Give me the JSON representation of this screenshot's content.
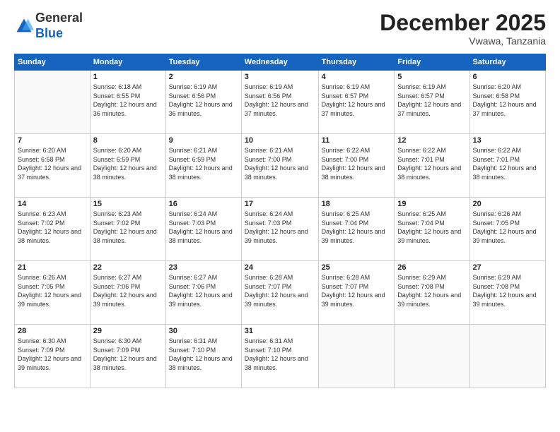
{
  "logo": {
    "general": "General",
    "blue": "Blue"
  },
  "title": "December 2025",
  "location": "Vwawa, Tanzania",
  "days_of_week": [
    "Sunday",
    "Monday",
    "Tuesday",
    "Wednesday",
    "Thursday",
    "Friday",
    "Saturday"
  ],
  "weeks": [
    [
      {
        "day": "",
        "info": ""
      },
      {
        "day": "1",
        "info": "Sunrise: 6:18 AM\nSunset: 6:55 PM\nDaylight: 12 hours\nand 36 minutes."
      },
      {
        "day": "2",
        "info": "Sunrise: 6:19 AM\nSunset: 6:56 PM\nDaylight: 12 hours\nand 36 minutes."
      },
      {
        "day": "3",
        "info": "Sunrise: 6:19 AM\nSunset: 6:56 PM\nDaylight: 12 hours\nand 37 minutes."
      },
      {
        "day": "4",
        "info": "Sunrise: 6:19 AM\nSunset: 6:57 PM\nDaylight: 12 hours\nand 37 minutes."
      },
      {
        "day": "5",
        "info": "Sunrise: 6:19 AM\nSunset: 6:57 PM\nDaylight: 12 hours\nand 37 minutes."
      },
      {
        "day": "6",
        "info": "Sunrise: 6:20 AM\nSunset: 6:58 PM\nDaylight: 12 hours\nand 37 minutes."
      }
    ],
    [
      {
        "day": "7",
        "info": "Sunrise: 6:20 AM\nSunset: 6:58 PM\nDaylight: 12 hours\nand 37 minutes."
      },
      {
        "day": "8",
        "info": "Sunrise: 6:20 AM\nSunset: 6:59 PM\nDaylight: 12 hours\nand 38 minutes."
      },
      {
        "day": "9",
        "info": "Sunrise: 6:21 AM\nSunset: 6:59 PM\nDaylight: 12 hours\nand 38 minutes."
      },
      {
        "day": "10",
        "info": "Sunrise: 6:21 AM\nSunset: 7:00 PM\nDaylight: 12 hours\nand 38 minutes."
      },
      {
        "day": "11",
        "info": "Sunrise: 6:22 AM\nSunset: 7:00 PM\nDaylight: 12 hours\nand 38 minutes."
      },
      {
        "day": "12",
        "info": "Sunrise: 6:22 AM\nSunset: 7:01 PM\nDaylight: 12 hours\nand 38 minutes."
      },
      {
        "day": "13",
        "info": "Sunrise: 6:22 AM\nSunset: 7:01 PM\nDaylight: 12 hours\nand 38 minutes."
      }
    ],
    [
      {
        "day": "14",
        "info": "Sunrise: 6:23 AM\nSunset: 7:02 PM\nDaylight: 12 hours\nand 38 minutes."
      },
      {
        "day": "15",
        "info": "Sunrise: 6:23 AM\nSunset: 7:02 PM\nDaylight: 12 hours\nand 38 minutes."
      },
      {
        "day": "16",
        "info": "Sunrise: 6:24 AM\nSunset: 7:03 PM\nDaylight: 12 hours\nand 38 minutes."
      },
      {
        "day": "17",
        "info": "Sunrise: 6:24 AM\nSunset: 7:03 PM\nDaylight: 12 hours\nand 39 minutes."
      },
      {
        "day": "18",
        "info": "Sunrise: 6:25 AM\nSunset: 7:04 PM\nDaylight: 12 hours\nand 39 minutes."
      },
      {
        "day": "19",
        "info": "Sunrise: 6:25 AM\nSunset: 7:04 PM\nDaylight: 12 hours\nand 39 minutes."
      },
      {
        "day": "20",
        "info": "Sunrise: 6:26 AM\nSunset: 7:05 PM\nDaylight: 12 hours\nand 39 minutes."
      }
    ],
    [
      {
        "day": "21",
        "info": "Sunrise: 6:26 AM\nSunset: 7:05 PM\nDaylight: 12 hours\nand 39 minutes."
      },
      {
        "day": "22",
        "info": "Sunrise: 6:27 AM\nSunset: 7:06 PM\nDaylight: 12 hours\nand 39 minutes."
      },
      {
        "day": "23",
        "info": "Sunrise: 6:27 AM\nSunset: 7:06 PM\nDaylight: 12 hours\nand 39 minutes."
      },
      {
        "day": "24",
        "info": "Sunrise: 6:28 AM\nSunset: 7:07 PM\nDaylight: 12 hours\nand 39 minutes."
      },
      {
        "day": "25",
        "info": "Sunrise: 6:28 AM\nSunset: 7:07 PM\nDaylight: 12 hours\nand 39 minutes."
      },
      {
        "day": "26",
        "info": "Sunrise: 6:29 AM\nSunset: 7:08 PM\nDaylight: 12 hours\nand 39 minutes."
      },
      {
        "day": "27",
        "info": "Sunrise: 6:29 AM\nSunset: 7:08 PM\nDaylight: 12 hours\nand 39 minutes."
      }
    ],
    [
      {
        "day": "28",
        "info": "Sunrise: 6:30 AM\nSunset: 7:09 PM\nDaylight: 12 hours\nand 39 minutes."
      },
      {
        "day": "29",
        "info": "Sunrise: 6:30 AM\nSunset: 7:09 PM\nDaylight: 12 hours\nand 38 minutes."
      },
      {
        "day": "30",
        "info": "Sunrise: 6:31 AM\nSunset: 7:10 PM\nDaylight: 12 hours\nand 38 minutes."
      },
      {
        "day": "31",
        "info": "Sunrise: 6:31 AM\nSunset: 7:10 PM\nDaylight: 12 hours\nand 38 minutes."
      },
      {
        "day": "",
        "info": ""
      },
      {
        "day": "",
        "info": ""
      },
      {
        "day": "",
        "info": ""
      }
    ]
  ]
}
